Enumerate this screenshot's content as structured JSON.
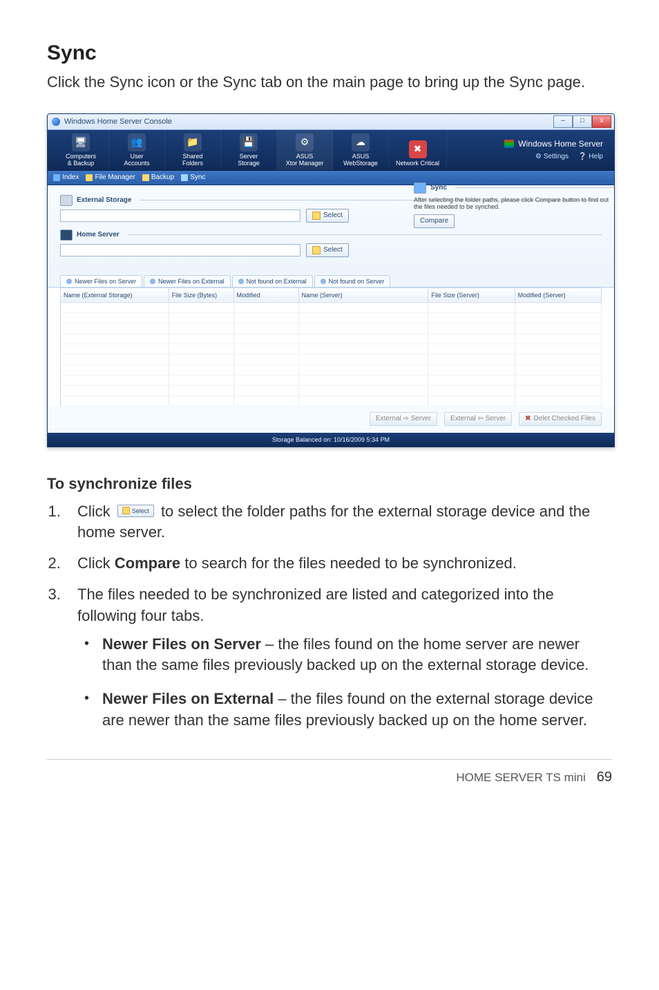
{
  "heading": "Sync",
  "intro": "Click the Sync icon or the Sync tab on the main page to bring up the Sync page.",
  "app": {
    "title": "Windows Home Server Console",
    "win_min": "–",
    "win_max": "□",
    "win_close": "x",
    "toolbar": [
      {
        "label": "Computers\n& Backup",
        "glyph": "🖥"
      },
      {
        "label": "User\nAccounts",
        "glyph": "👥"
      },
      {
        "label": "Shared\nFolders",
        "glyph": "📁"
      },
      {
        "label": "Server\nStorage",
        "glyph": "💾"
      },
      {
        "label": "ASUS\nXtor Manager",
        "glyph": "⚙"
      },
      {
        "label": "ASUS\nWebStorage",
        "glyph": "☁"
      },
      {
        "label": "Network\nCritical",
        "glyph": "✖"
      }
    ],
    "brand": "Windows Home Server",
    "links": {
      "settings": "Settings",
      "help": "Help"
    },
    "breadcrumb": {
      "index": "Index",
      "file_manager": "File Manager",
      "backup": "Backup",
      "sync": "Sync"
    },
    "groups": {
      "external": {
        "label": "External Storage",
        "select": "Select"
      },
      "home": {
        "label": "Home Server",
        "select": "Select"
      }
    },
    "sync_panel": {
      "title": "Sync",
      "desc": "After selecting the folder paths, please click Compare button to find out the files needed to be synched.",
      "compare": "Compare"
    },
    "tabs": {
      "newer_server": "Newer Files on Server",
      "newer_external": "Newer Files on External",
      "not_external": "Not found on External",
      "not_server": "Not found on Server"
    },
    "columns": {
      "name_ext": "Name (External Storage)",
      "size": "File Size (Bytes)",
      "modified": "Modified",
      "name_srv": "Name (Server)",
      "size_srv": "File Size (Server)",
      "modified_srv": "Modified (Server)"
    },
    "bottom": {
      "ext_to_srv": "External ⇨   Server",
      "srv_to_ext": "External ⇦   Server",
      "delete": "Delet Checked Files"
    },
    "status": "Storage Balanced on: 10/16/2009 5:34 PM"
  },
  "instructions": {
    "subheading": "To synchronize files",
    "step1a": "Click",
    "step1_btn": "Select",
    "step1b": "to select the folder paths for the external storage device and the home server.",
    "step2a": "Click ",
    "step2_bold": "Compare",
    "step2b": " to search for the files needed to be synchronized.",
    "step3": "The files needed to be synchronized are listed and categorized into the following four tabs.",
    "bullets": {
      "b1_bold": "Newer Files on Server",
      "b1_rest": " – the files found on the home server are newer than the same files previously backed up on the external storage device.",
      "b2_bold": "Newer Files on External",
      "b2_rest": " – the files found on the external storage device are newer than the same files previously backed up on the home server."
    }
  },
  "footer": {
    "product": "HOME SERVER TS mini",
    "page": "69"
  }
}
